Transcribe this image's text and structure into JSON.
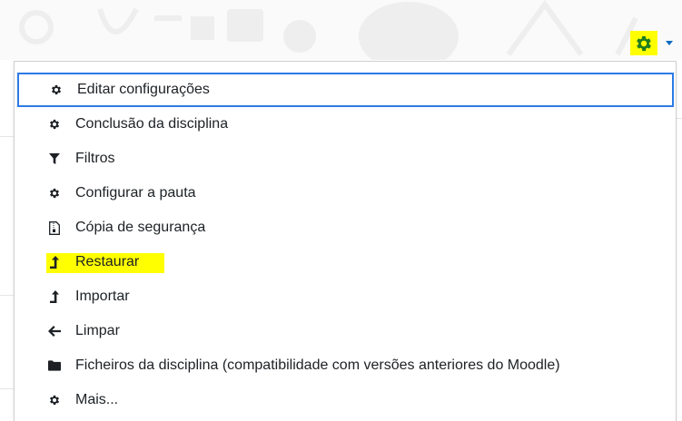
{
  "menu": {
    "items": [
      {
        "label": "Editar configurações",
        "icon": "gear-icon",
        "active": true
      },
      {
        "label": "Conclusão da disciplina",
        "icon": "gear-icon"
      },
      {
        "label": "Filtros",
        "icon": "filter-icon"
      },
      {
        "label": "Configurar a pauta",
        "icon": "gear-icon"
      },
      {
        "label": "Cópia de segurança",
        "icon": "file-archive-icon"
      },
      {
        "label": "Restaurar",
        "icon": "level-up-icon",
        "highlighted": true
      },
      {
        "label": "Importar",
        "icon": "level-up-icon"
      },
      {
        "label": "Limpar",
        "icon": "arrow-left-icon"
      },
      {
        "label": "Ficheiros da disciplina (compatibilidade com versões anteriores do Moodle)",
        "icon": "folder-icon"
      },
      {
        "label": "Mais...",
        "icon": "gear-icon"
      }
    ]
  },
  "colors": {
    "highlight": "#ffff00",
    "focus_border": "#2c7be5",
    "caret": "#0f6cbf",
    "text": "#1d2125",
    "gear_toggle": "#1e7d1e"
  }
}
